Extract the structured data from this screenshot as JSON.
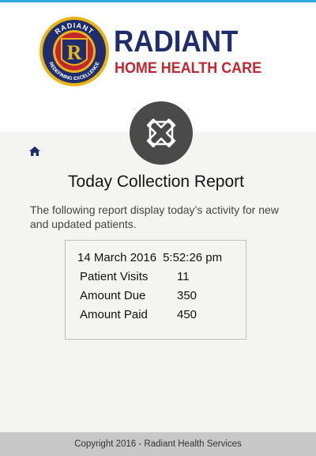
{
  "brand": {
    "badge_top_text": "RADIANT",
    "badge_bottom_text": "REDEFINING EXCELLENCE",
    "badge_letter": "R",
    "name": "RADIANT",
    "subtitle": "HOME HEALTH CARE",
    "colors": {
      "navy": "#1f2d6e",
      "red": "#c2262e",
      "gold": "#e9b514"
    }
  },
  "app_icon": "medical-cross-icon",
  "nav": {
    "home_icon": "home-icon"
  },
  "page": {
    "title": "Today Collection Report",
    "description": "The following report display today’s activity for new and updated patients."
  },
  "report": {
    "date": "14 March 2016",
    "time": "5:52:26 pm",
    "rows": [
      {
        "label": "Patient Visits",
        "value": "11"
      },
      {
        "label": "Amount Due",
        "value": "350"
      },
      {
        "label": "Amount Paid",
        "value": "450"
      }
    ]
  },
  "footer": {
    "text": "Copyright 2016 - Radiant Health Services"
  },
  "colors": {
    "accent_bar": "#2fa4d8",
    "background": "#f4f4f2",
    "footer_bg": "#c8c8c8",
    "icon_circle": "#4a4a4a"
  }
}
